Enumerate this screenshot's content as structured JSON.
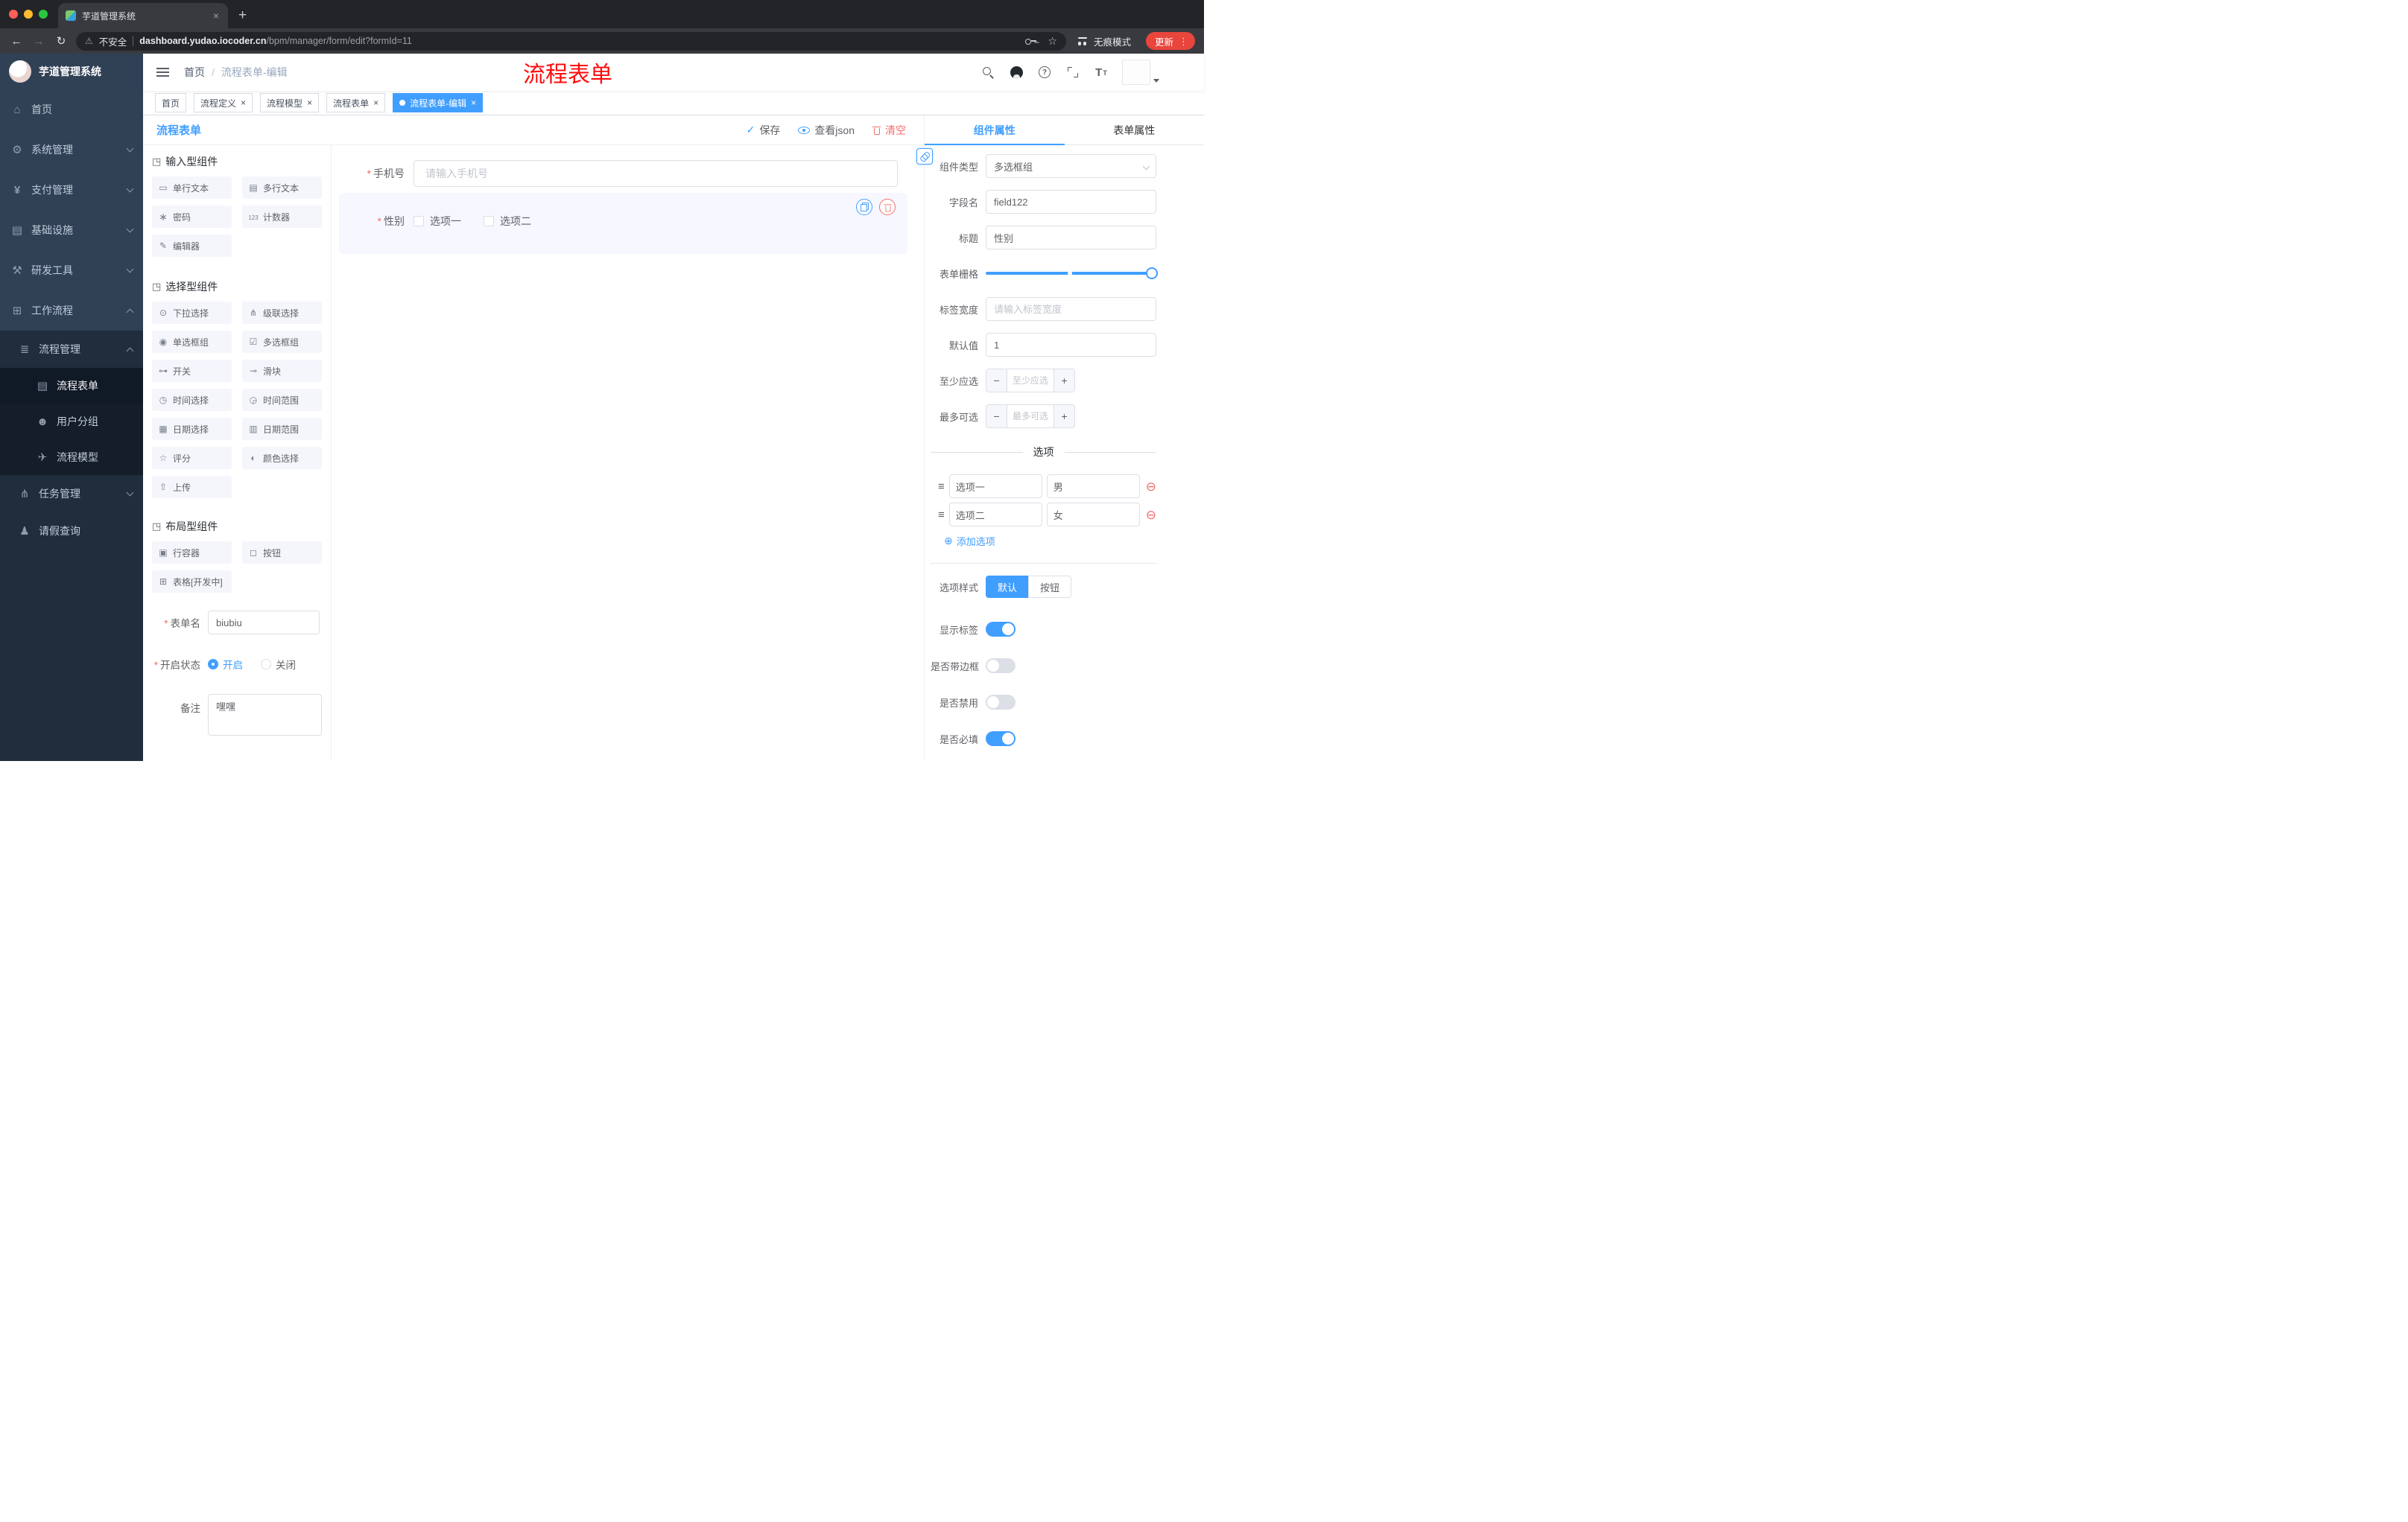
{
  "browser": {
    "tab_title": "芋道管理系统",
    "security_label": "不安全",
    "url_domain": "dashboard.yudao.iocoder.cn",
    "url_path": "/bpm/manager/form/edit?formId=11",
    "incognito_label": "无痕模式",
    "update_label": "更新"
  },
  "sidebar": {
    "brand": "芋道管理系统",
    "items": [
      {
        "icon": "dashboard-icon",
        "label": "首页"
      },
      {
        "icon": "gear-icon",
        "label": "系统管理"
      },
      {
        "icon": "yen-icon",
        "label": "支付管理"
      },
      {
        "icon": "infra-icon",
        "label": "基础设施"
      },
      {
        "icon": "tools-icon",
        "label": "研发工具"
      },
      {
        "icon": "workflow-icon",
        "label": "工作流程"
      }
    ],
    "workflow": {
      "process_manage": "流程管理",
      "children": [
        "流程表单",
        "用户分组",
        "流程模型"
      ],
      "task_manage": "任务管理",
      "leave_query": "请假查询"
    }
  },
  "header": {
    "breadcrumb": {
      "home": "首页",
      "separator": "/",
      "current": "流程表单-编辑"
    },
    "annotation": "流程表单"
  },
  "tags": [
    {
      "label": "首页",
      "closable": false,
      "active": false
    },
    {
      "label": "流程定义",
      "closable": true,
      "active": false
    },
    {
      "label": "流程模型",
      "closable": true,
      "active": false
    },
    {
      "label": "流程表单",
      "closable": true,
      "active": false
    },
    {
      "label": "流程表单-编辑",
      "closable": true,
      "active": true
    }
  ],
  "designer": {
    "title": "流程表单",
    "actions": {
      "save": "保存",
      "view_json": "查看json",
      "clear": "清空"
    }
  },
  "palette": {
    "sections": [
      {
        "title": "输入型组件",
        "items": [
          "单行文本",
          "多行文本",
          "密码",
          "计数器",
          "编辑器"
        ]
      },
      {
        "title": "选择型组件",
        "items": [
          "下拉选择",
          "级联选择",
          "单选框组",
          "多选框组",
          "开关",
          "滑块",
          "时间选择",
          "时间范围",
          "日期选择",
          "日期范围",
          "评分",
          "颜色选择",
          "上传"
        ]
      },
      {
        "title": "布局型组件",
        "items": [
          "行容器",
          "按钮",
          "表格[开发中]"
        ]
      }
    ]
  },
  "meta": {
    "form_name": {
      "label": "表单名",
      "value": "biubiu"
    },
    "status": {
      "label": "开启状态",
      "on": "开启",
      "off": "关闭"
    },
    "remark": {
      "label": "备注",
      "value": "嘿嘿"
    }
  },
  "canvas": {
    "phone": {
      "label": "手机号",
      "placeholder": "请输入手机号"
    },
    "gender": {
      "label": "性别",
      "option1": "选项一",
      "option2": "选项二"
    }
  },
  "props": {
    "tabs": {
      "component": "组件属性",
      "form": "表单属性"
    },
    "component_type": {
      "label": "组件类型",
      "value": "多选框组"
    },
    "field_name": {
      "label": "字段名",
      "value": "field122"
    },
    "title": {
      "label": "标题",
      "value": "性别"
    },
    "grid": {
      "label": "表单栅格"
    },
    "label_width": {
      "label": "标签宽度",
      "placeholder": "请输入标签宽度"
    },
    "default_value": {
      "label": "默认值",
      "value": "1"
    },
    "min_select": {
      "label": "至少应选",
      "placeholder": "至少应选"
    },
    "max_select": {
      "label": "最多可选",
      "placeholder": "最多可选"
    },
    "options_title": "选项",
    "options": [
      {
        "name": "选项一",
        "value": "男"
      },
      {
        "name": "选项二",
        "value": "女"
      }
    ],
    "add_option": "添加选项",
    "option_style": {
      "label": "选项样式",
      "default": "默认",
      "button": "按钮",
      "active": "默认"
    },
    "switches": [
      {
        "label": "显示标签",
        "on": true
      },
      {
        "label": "是否带边框",
        "on": false
      },
      {
        "label": "是否禁用",
        "on": false
      },
      {
        "label": "是否必填",
        "on": true
      }
    ]
  },
  "colors": {
    "accent": "#409eff",
    "danger": "#f56c6c",
    "annotation_red": "#fd0c0c",
    "update_button": "#e8453c",
    "sidebar_bg": "#304156",
    "sidebar_sub_bg": "#1f2d3d"
  }
}
